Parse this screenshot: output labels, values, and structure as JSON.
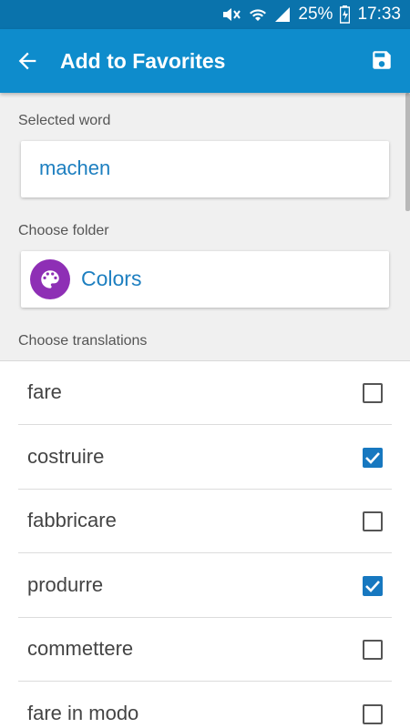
{
  "status_bar": {
    "battery": "25%",
    "time": "17:33",
    "icons": [
      "mute-icon",
      "wifi-icon",
      "signal-icon",
      "battery-icon"
    ]
  },
  "app_bar": {
    "title": "Add to Favorites",
    "back_icon": "arrow-left-icon",
    "save_icon": "save-floppy-icon"
  },
  "selected_word": {
    "label": "Selected word",
    "value": "machen"
  },
  "folder": {
    "label": "Choose folder",
    "name": "Colors",
    "icon": "palette-icon",
    "icon_color": "#8e2fb5"
  },
  "translations": {
    "label": "Choose translations",
    "items": [
      {
        "text": "fare",
        "checked": false
      },
      {
        "text": "costruire",
        "checked": true
      },
      {
        "text": "fabbricare",
        "checked": false
      },
      {
        "text": "produrre",
        "checked": true
      },
      {
        "text": "commettere",
        "checked": false
      },
      {
        "text": "fare in modo",
        "checked": false
      }
    ]
  },
  "colors": {
    "app_bar": "#0e8ccc",
    "status_bar": "#0a73ac",
    "accent": "#1778c0"
  }
}
